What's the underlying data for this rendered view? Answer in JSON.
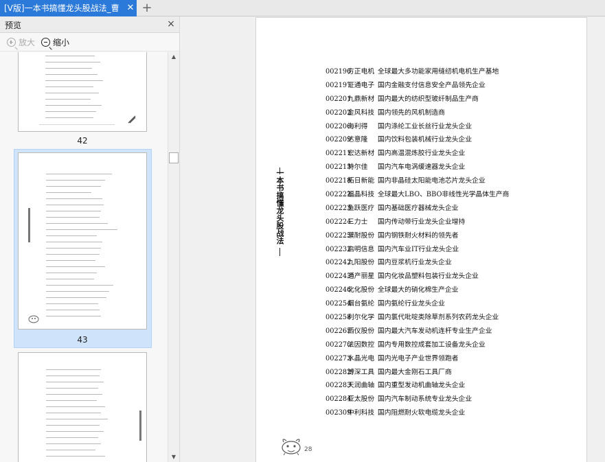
{
  "tabs": [
    {
      "label": "[V版]一本书搞懂龙头股战法_曹",
      "close_glyph": "✕"
    }
  ],
  "new_tab_glyph": "+",
  "preview_panel": {
    "title": "预览",
    "close_glyph": "×",
    "zoom_in_label": "放大",
    "zoom_out_label": "缩小",
    "thumbnails": [
      {
        "page_number": "42",
        "selected": false
      },
      {
        "page_number": "43",
        "selected": true
      },
      {
        "page_number": "",
        "selected": false
      }
    ]
  },
  "document": {
    "side_title": "一本书搞懂龙头股战法",
    "page_number": "28",
    "entries": [
      {
        "code": "002196",
        "name": "方正电机",
        "desc": "全球最大多功能家用缝纫机电机生产基地"
      },
      {
        "code": "002197",
        "name": "证通电子",
        "desc": "国内金融支付信息安全产品领先企业"
      },
      {
        "code": "002201",
        "name": "九鼎新材",
        "desc": "国内最大的纺织型玻纤制品生产商"
      },
      {
        "code": "002202",
        "name": "金风科技",
        "desc": "国内领先的风机制造商"
      },
      {
        "code": "002206",
        "name": "海利得",
        "desc": "国内涤纶工业长丝行业龙头企业"
      },
      {
        "code": "002209",
        "name": "达意隆",
        "desc": "国内饮料包装机械行业龙头企业"
      },
      {
        "code": "002211",
        "name": "宏达新材",
        "desc": "国内高温混炼胶行业龙头企业"
      },
      {
        "code": "002213",
        "name": "特尔佳",
        "desc": "国内汽车电涡缓速器龙头企业"
      },
      {
        "code": "002218",
        "name": "拓日新能",
        "desc": "国内非晶硅太阳能电池芯片龙头企业"
      },
      {
        "code": "002222",
        "name": "福晶科技",
        "desc": "全球最大LBO、BBO非线性光学晶体生产商"
      },
      {
        "code": "002223",
        "name": "鱼跃医疗",
        "desc": "国内基础医疗器械龙头企业"
      },
      {
        "code": "002224",
        "name": "三力士",
        "desc": "国内传动带行业龙头企业增持"
      },
      {
        "code": "002225",
        "name": "濮耐股份",
        "desc": "国内钢铁耐火材料的领先者"
      },
      {
        "code": "002232",
        "name": "启明信息",
        "desc": "国内汽车业IT行业龙头企业"
      },
      {
        "code": "002242",
        "name": "九阳股份",
        "desc": "国内豆浆机行业龙头企业"
      },
      {
        "code": "002243",
        "name": "通产丽星",
        "desc": "国内化妆品塑料包装行业龙头企业"
      },
      {
        "code": "002246",
        "name": "北化股份",
        "desc": "全球最大的硝化棉生产企业"
      },
      {
        "code": "002254",
        "name": "烟台氨纶",
        "desc": "国内氨纶行业龙头企业"
      },
      {
        "code": "002258",
        "name": "利尔化学",
        "desc": "国内氯代吡啶类除草剂系列农药龙头企业"
      },
      {
        "code": "002265",
        "name": "西仪股份",
        "desc": "国内最大汽车发动机连杆专业生产企业"
      },
      {
        "code": "002270",
        "name": "法因数控",
        "desc": "国内专用数控成套加工设备龙头企业"
      },
      {
        "code": "002273",
        "name": "水晶光电",
        "desc": "国内光电子产业世界领跑者"
      },
      {
        "code": "002282",
        "name": "博深工具",
        "desc": "国内最大金刚石工具厂商"
      },
      {
        "code": "002283",
        "name": "天润曲轴",
        "desc": "国内重型发动机曲轴龙头企业"
      },
      {
        "code": "002284",
        "name": "亚太股份",
        "desc": "国内汽车制动系统专业龙头企业"
      },
      {
        "code": "002309",
        "name": "中利科技",
        "desc": "国内阻燃耐火软电缆龙头企业"
      }
    ]
  },
  "colors": {
    "tab_active": "#2b79d8",
    "selection": "#cfe3fb"
  }
}
